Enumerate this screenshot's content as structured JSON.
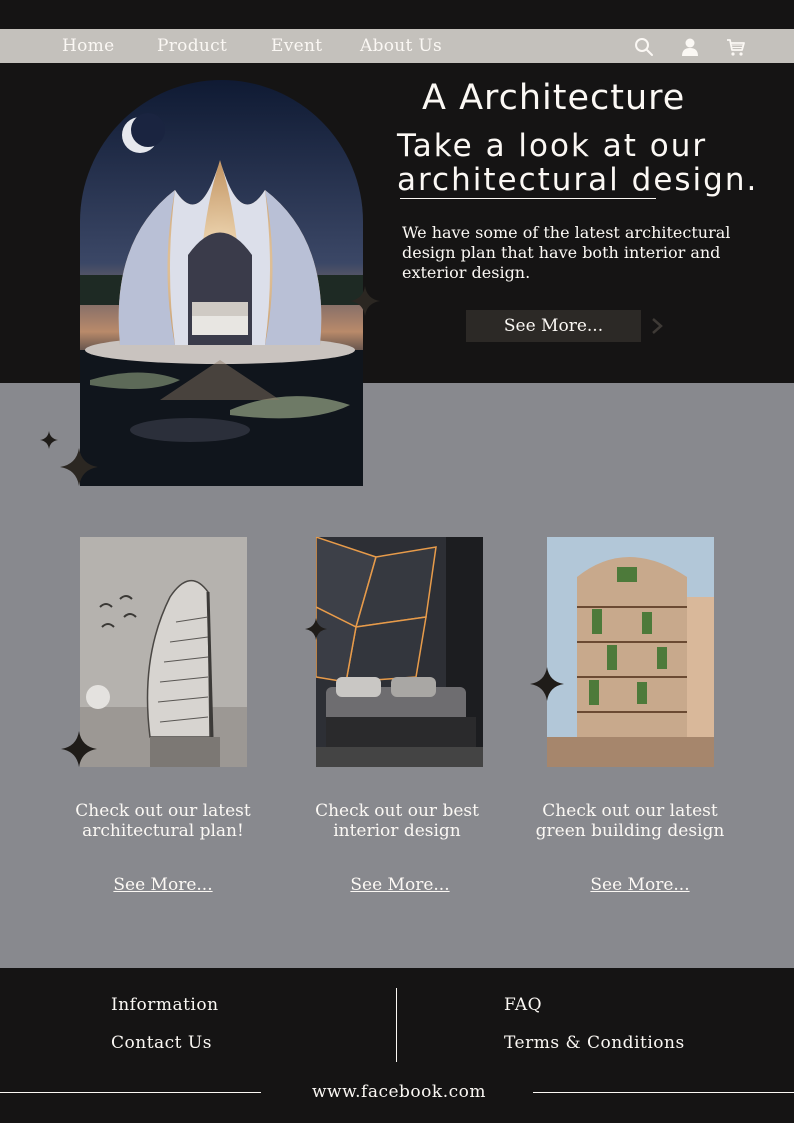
{
  "nav": {
    "items": [
      "Home",
      "Product",
      "Event",
      "About Us"
    ],
    "icons": [
      "search-icon",
      "user-icon",
      "cart-icon"
    ]
  },
  "hero": {
    "brand": "A Architecture",
    "headline_line1": "Take a look at our",
    "headline_line2": "architectural design.",
    "description": "We have some of the latest architectural design plan that have both interior and exterior design.",
    "button_label": "See More..."
  },
  "cards": [
    {
      "title": "Check out our latest architectural plan!",
      "link": "See More..."
    },
    {
      "title": "Check out our best interior design",
      "link": "See More..."
    },
    {
      "title": "Check out our latest green building design",
      "link": "See More..."
    }
  ],
  "footer": {
    "information": "Information",
    "contact": "Contact Us",
    "faq": "FAQ",
    "terms": "Terms & Conditions",
    "website": "www.facebook.com"
  },
  "colors": {
    "dark": "#151414",
    "gray": "#88898e",
    "nav": "#c4c1bc",
    "text": "#fbf8f4",
    "button": "#2c2926"
  }
}
